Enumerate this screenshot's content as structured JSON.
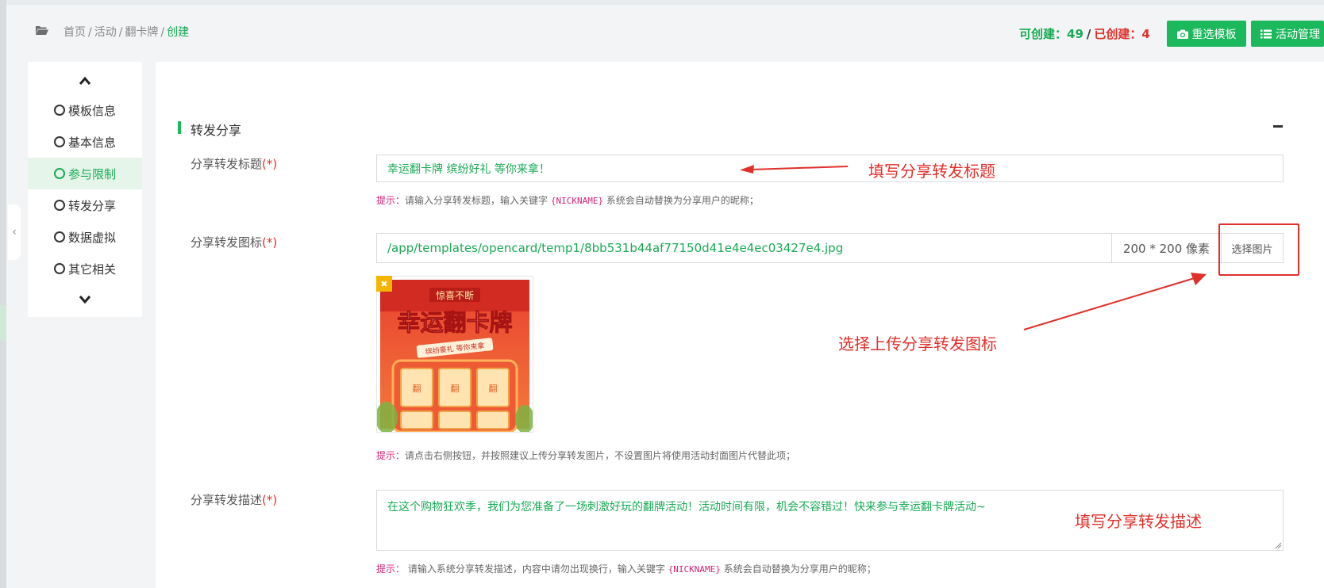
{
  "breadcrumb": {
    "items": [
      "首页",
      "活动",
      "翻卡牌"
    ],
    "current": "创建",
    "separator": "/"
  },
  "counter": {
    "can_create_label": "可创建：",
    "can_create_value": "49",
    "separator": "/",
    "created_label": "已创建：",
    "created_value": "4"
  },
  "actions": {
    "reselect_template": "重选模板",
    "activity_manage": "活动管理"
  },
  "nav": {
    "items": [
      {
        "label": "模板信息",
        "active": false
      },
      {
        "label": "基本信息",
        "active": false
      },
      {
        "label": "参与限制",
        "active": true
      },
      {
        "label": "转发分享",
        "active": false
      },
      {
        "label": "数据虚拟",
        "active": false
      },
      {
        "label": "其它相关",
        "active": false
      }
    ],
    "collapse_glyph": "‹"
  },
  "section": {
    "title": "转发分享"
  },
  "share_title": {
    "label": "分享转发标题",
    "required": "(*)",
    "value": "幸运翻卡牌 缤纷好礼 等你来拿！",
    "hint_tag": "提示：",
    "hint_text_1": "请输入分享转发标题，输入关键字",
    "hint_keyword": "{NICKNAME}",
    "hint_text_2": "系统会自动替换为分享用户的昵称；"
  },
  "share_icon": {
    "label": "分享转发图标",
    "required": "(*)",
    "value": "/app/templates/opencard/temp1/8bb531b44af77150d41e4e4ec03427e4.jpg",
    "size_addon": "200 * 200 像素",
    "select_button": "选择图片",
    "remove_glyph": "✖",
    "hint_tag": "提示：",
    "hint_text": "请点击右侧按钮，并按照建议上传分享转发图片，不设置图片将使用活动封面图片代替此项；"
  },
  "thumbnail": {
    "banner_text": "惊喜不断",
    "title_text": "幸运翻卡牌",
    "ribbon_text": "缤纷豪礼 等你来拿",
    "card_glyph": "翻"
  },
  "share_desc": {
    "label": "分享转发描述",
    "required": "(*)",
    "value": "在这个购物狂欢季，我们为您准备了一场刺激好玩的翻牌活动！活动时间有限，机会不容错过！快来参与幸运翻卡牌活动~",
    "hint_tag": "提示：",
    "hint_text_1": "请输入系统分享转发描述，内容中请勿出现换行，输入关键字",
    "hint_keyword": "{NICKNAME}",
    "hint_text_2": "系统会自动替换为分享用户的昵称；"
  },
  "annotations": {
    "title_note": "填写分享转发标题",
    "icon_note": "选择上传分享转发图标",
    "desc_note": "填写分享转发描述"
  },
  "colors": {
    "accent_green": "#1cb85c",
    "annotation_red": "#e0302b",
    "hint_pink": "#d4237a"
  }
}
